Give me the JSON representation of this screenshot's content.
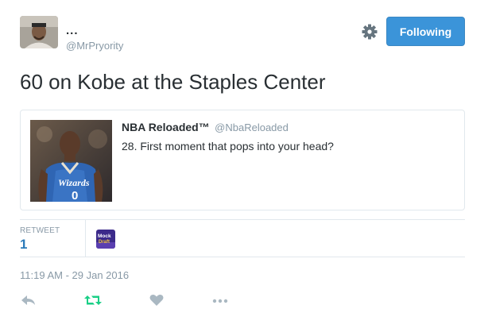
{
  "user": {
    "display_name": "...",
    "handle": "@MrPryority"
  },
  "follow_button": {
    "label": "Following"
  },
  "tweet": {
    "text": "60 on Kobe at the Staples Center"
  },
  "quoted_tweet": {
    "name": "NBA Reloaded™",
    "handle": "@NbaReloaded",
    "text": "28. First moment that pops into your head?"
  },
  "stats": {
    "retweet_label": "RETWEET",
    "retweet_count": "1",
    "retweeter_avatar_text": "Mock Draft"
  },
  "timestamp": "11:19 AM - 29 Jan 2016",
  "icons": {
    "settings": "gear-icon",
    "reply": "reply-icon",
    "retweet": "retweet-icon",
    "like": "heart-icon",
    "more": "more-icon"
  },
  "colors": {
    "follow_button": "#3b94d9",
    "retweet_action": "#19cf86",
    "muted": "#aab8c2",
    "link": "#2b7bb9"
  }
}
